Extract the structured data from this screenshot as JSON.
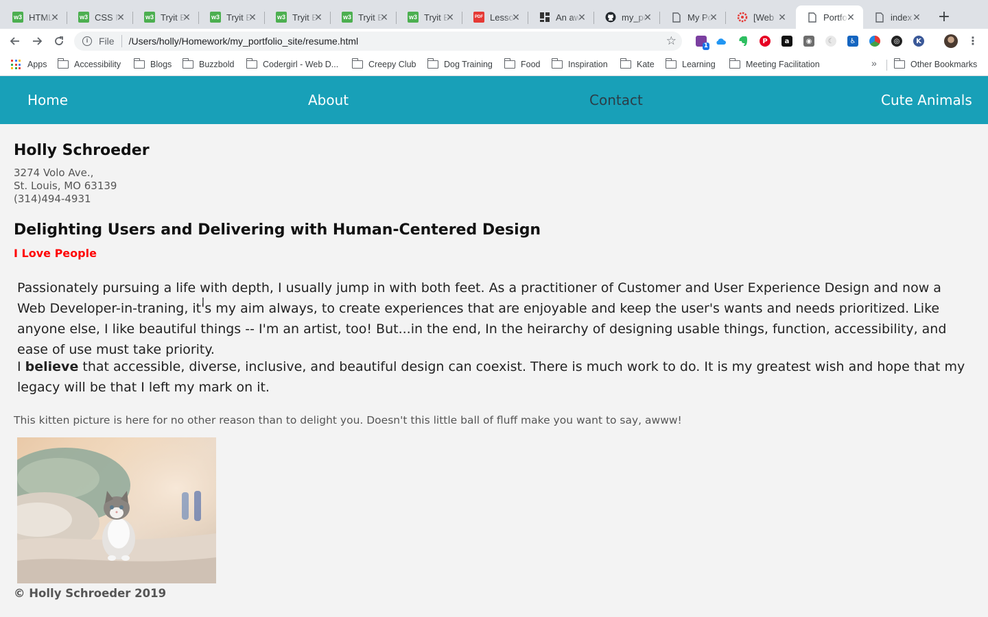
{
  "browser": {
    "tabs": [
      {
        "label": "HTML",
        "favicon": "w3schools-icon"
      },
      {
        "label": "CSS N",
        "favicon": "w3schools-icon"
      },
      {
        "label": "Tryit E",
        "favicon": "w3schools-icon"
      },
      {
        "label": "Tryit E",
        "favicon": "w3schools-icon"
      },
      {
        "label": "Tryit E",
        "favicon": "w3schools-icon"
      },
      {
        "label": "Tryit E",
        "favicon": "w3schools-icon"
      },
      {
        "label": "Tryit E",
        "favicon": "w3schools-icon"
      },
      {
        "label": "Lesso",
        "favicon": "pdf-icon"
      },
      {
        "label": "An aw",
        "favicon": "dashboard-icon"
      },
      {
        "label": "my_po",
        "favicon": "github-icon"
      },
      {
        "label": "My Po",
        "favicon": "page-icon"
      },
      {
        "label": "[Web",
        "favicon": "settings-flower-icon"
      },
      {
        "label": "Portfo",
        "favicon": "page-icon",
        "active": true
      },
      {
        "label": "index",
        "favicon": "page-icon"
      }
    ],
    "address_bar": {
      "scheme": "File",
      "url": "/Users/holly/Homework/my_portfolio_site/resume.html"
    },
    "extension_badge": "1",
    "bookmarks": {
      "apps_label": "Apps",
      "items": [
        "Accessibility",
        "Blogs",
        "Buzzbold",
        "Codergirl - Web D...",
        "Creepy Club",
        "Dog Training",
        "Food",
        "Inspiration",
        "Kate",
        "Learning",
        "Meeting Facilitation"
      ],
      "overflow": "»",
      "other": "Other Bookmarks"
    }
  },
  "site": {
    "nav": [
      "Home",
      "About",
      "Contact",
      "Cute Animals"
    ],
    "name": "Holly Schroeder",
    "address": {
      "street": "3274 Volo Ave.,",
      "city": "St. Louis, MO 63139",
      "phone": "(314)494-4931"
    },
    "headline": "Delighting Users and Delivering with Human-Centered Design",
    "subhead": "I Love People",
    "paragraph1": "Passionately pursuing a life with depth, I usually jump in with both feet. As a practitioner of Customer and User Experience Design and now a Web Developer-in-traning, it's my aim always, to create experiences that are enjoyable and keep the user's wants and needs prioritized. Like anyone else, I like beautiful things -- I'm an artist, too! But...in the end, In the heirarchy of designing usable things, function, accessibility, and ease of use must take priority.",
    "paragraph2": {
      "before": "I ",
      "bold": "believe",
      "after": " that accessible, diverse, inclusive, and beautiful design can coexist. There is much work to do. It is my greatest wish and hope that my legacy will be that I left my mark on it."
    },
    "caption": "This kitten picture is here for no other reason than to delight you. Doesn't this little ball of fluff make you want to say, awww!",
    "footer": "© Holly Schroeder 2019"
  },
  "colors": {
    "nav_bg": "#18a0b8",
    "nav_link": "#ffffff",
    "nav_link_current": "#2c3d47",
    "subhead": "#ff0000",
    "page_bg": "#f3f3f3"
  }
}
